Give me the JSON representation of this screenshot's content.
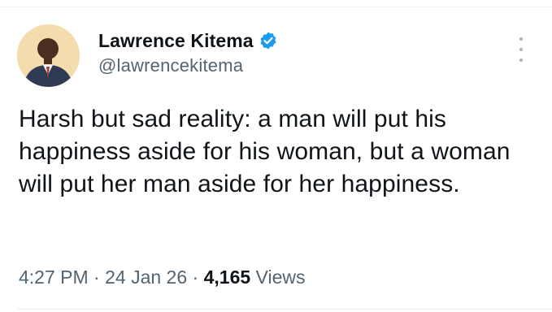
{
  "tweet": {
    "author": {
      "display_name": "Lawrence Kitema",
      "handle": "@lawrencekitema",
      "verified": true,
      "avatar_icon": "profile-photo"
    },
    "text": "Harsh but sad reality: a man will put his happiness aside for his woman, but a woman will put her man aside for her happiness.",
    "meta": {
      "time": "4:27 PM",
      "separator": "·",
      "date": "24 Jan 26",
      "views_count": "4,165",
      "views_label": "Views"
    },
    "more_icon": "more-vertical-icon"
  },
  "colors": {
    "verified_blue": "#1d9bf0",
    "text_primary": "#0f1419",
    "text_secondary": "#536471"
  }
}
